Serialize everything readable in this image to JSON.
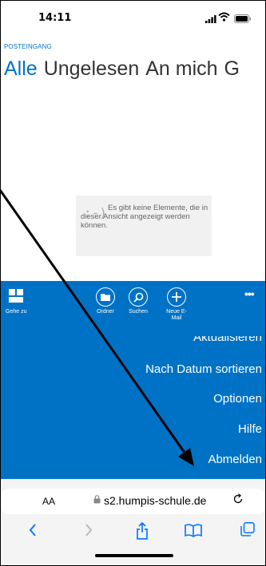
{
  "status_bar": {
    "time": "14:11"
  },
  "mail": {
    "section_label": "POSTEINGANG",
    "tabs": [
      "Alle",
      "Ungelesen",
      "An mich",
      "G"
    ],
    "empty_smiley": ":-)",
    "empty_message": "Es gibt keine Elemente, die in dieser Ansicht angezeigt werden können."
  },
  "command_bar": {
    "goto": "Gehe zu",
    "folder": "Ordner",
    "search": "Suchen",
    "new_mail": "Neue E-Mail",
    "more": "•••"
  },
  "overflow_menu": {
    "items": [
      "Aktualisieren",
      "Nach Datum sortieren",
      "Optionen",
      "Hilfe",
      "Abmelden"
    ]
  },
  "browser": {
    "text_size": "AA",
    "url": "s2.humpis-schule.de"
  },
  "colors": {
    "accent": "#0072c6",
    "ios_blue": "#0a7aff",
    "annotation_arrow": "#000000"
  }
}
